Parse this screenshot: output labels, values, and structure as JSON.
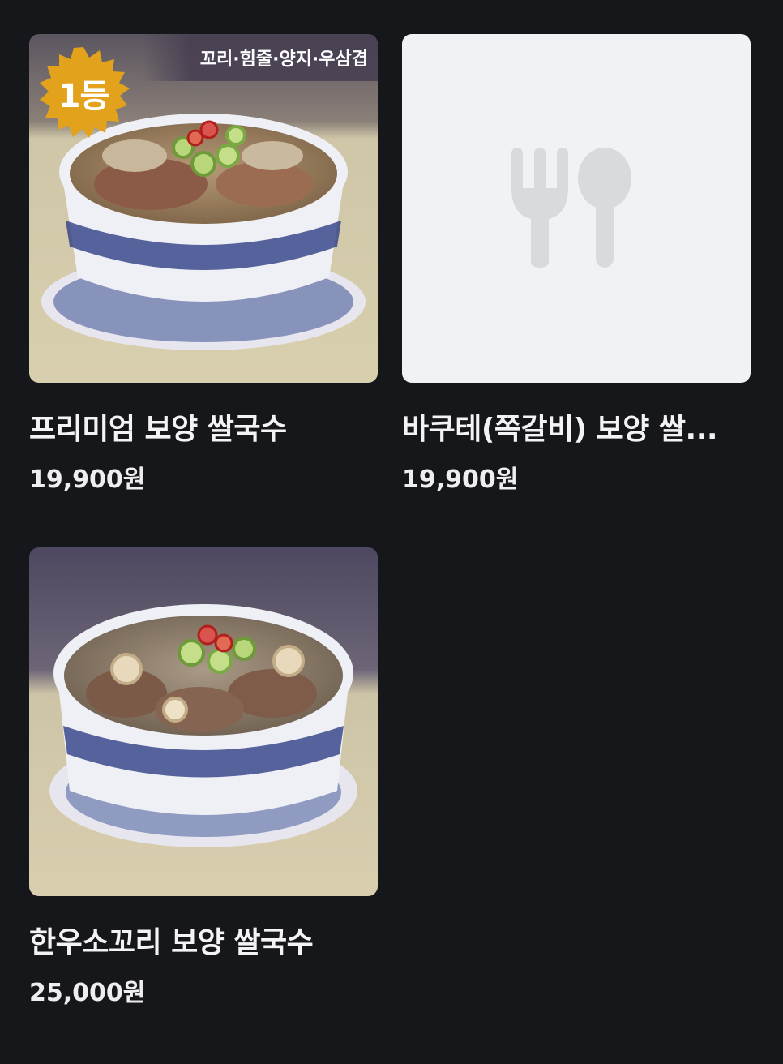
{
  "products": [
    {
      "name": "프리미엄 보양 쌀국수",
      "price": "19,900원",
      "badge": "1등",
      "tags": "꼬리·힘줄·양지·우삼겹",
      "image": "noodle-soup-bowl-photo"
    },
    {
      "name": "바쿠테(쪽갈비) 보양 쌀...",
      "price": "19,900원",
      "image": "fork-spoon-placeholder-icon"
    },
    {
      "name": "한우소꼬리 보양 쌀국수",
      "price": "25,000원",
      "image": "oxtail-soup-bowl-photo"
    }
  ],
  "colors": {
    "background": "#16171b",
    "placeholder_bg": "#f1f2f4",
    "placeholder_icon": "#d9dade",
    "badge_gold": "#e2a21c"
  }
}
